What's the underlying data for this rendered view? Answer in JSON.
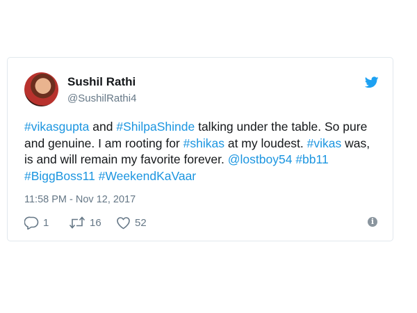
{
  "tweet": {
    "author": {
      "name": "Sushil Rathi",
      "handle": "@SushilRathi4"
    },
    "text_lines": [
      [
        {
          "t": "#vikasgupta",
          "link": true
        },
        {
          "t": " and ",
          "link": false
        },
        {
          "t": "#ShilpaShinde",
          "link": true
        },
        {
          "t": " talking under the table. So pure",
          "link": false
        }
      ],
      [
        {
          "t": "and genuine. I am rooting for ",
          "link": false
        },
        {
          "t": "#shikas",
          "link": true
        },
        {
          "t": " at my loudest. ",
          "link": false
        },
        {
          "t": "#vikas",
          "link": true
        },
        {
          "t": " was,",
          "link": false
        }
      ],
      [
        {
          "t": "is and will remain my favorite forever. ",
          "link": false
        },
        {
          "t": "@lostboy54",
          "link": true
        },
        {
          "t": " ",
          "link": false
        },
        {
          "t": "#bb11",
          "link": true
        }
      ],
      [
        {
          "t": "#BiggBoss11",
          "link": true
        },
        {
          "t": " ",
          "link": false
        },
        {
          "t": "#WeekendKaVaar",
          "link": true
        }
      ]
    ],
    "timestamp": "11:58 PM - Nov 12, 2017",
    "actions": {
      "reply_count": "1",
      "retweet_count": "16",
      "like_count": "52"
    }
  },
  "icons": {
    "brand": "twitter-bird-icon",
    "reply": "reply-icon",
    "retweet": "retweet-icon",
    "like": "heart-icon",
    "info": "info-icon"
  },
  "colors": {
    "link": "#1b95e0",
    "brand": "#1da1f2",
    "secondary_text": "#657786",
    "border": "#e1e8ed"
  }
}
